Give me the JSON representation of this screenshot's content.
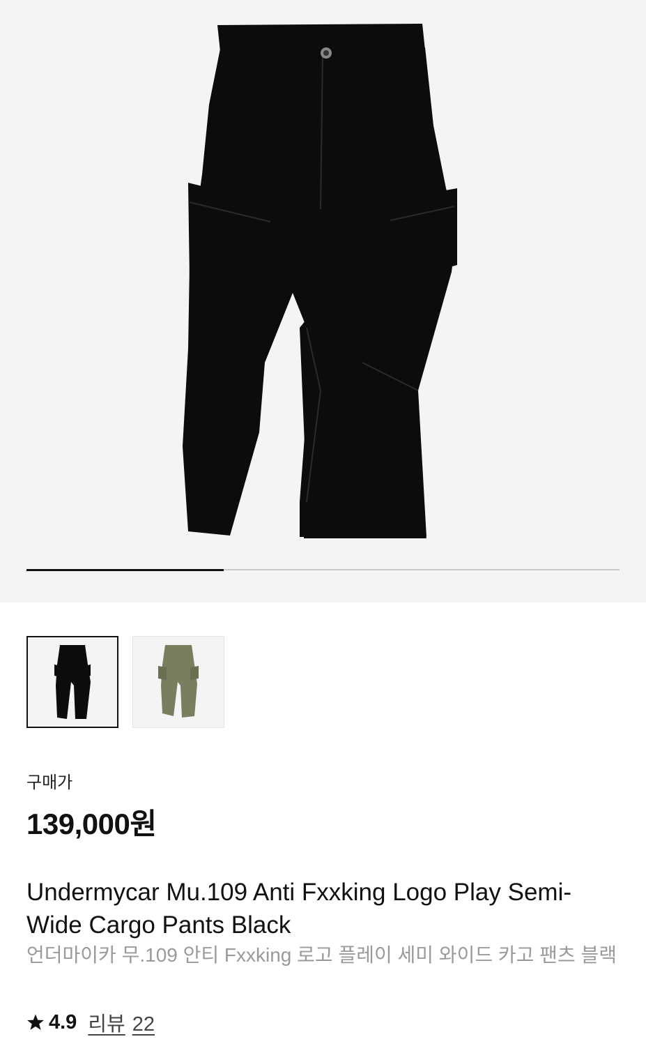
{
  "gallery": {
    "main_image": "black-cargo-pants-photo",
    "progress": 0.333,
    "thumbnails": [
      {
        "name": "black-variant",
        "color": "#0c0c0c",
        "selected": true
      },
      {
        "name": "olive-variant",
        "color": "#7a7d5e",
        "selected": false
      }
    ]
  },
  "product": {
    "price_label": "구매가",
    "price": "139,000원",
    "title": "Undermycar Mu.109 Anti Fxxking Logo Play Semi-Wide Cargo Pants Black",
    "subtitle": "언더마이카 무.109 안티 Fxxking 로고 플레이 세미 와이드 카고 팬츠 블랙",
    "rating": "4.9",
    "review_label": "리뷰",
    "review_count": "22"
  },
  "colors": {
    "hero_bg": "#f4f4f4",
    "pants_black": "#0c0c0c",
    "pants_olive": "#7a7d5e",
    "muted_text": "#9a9a9a"
  }
}
